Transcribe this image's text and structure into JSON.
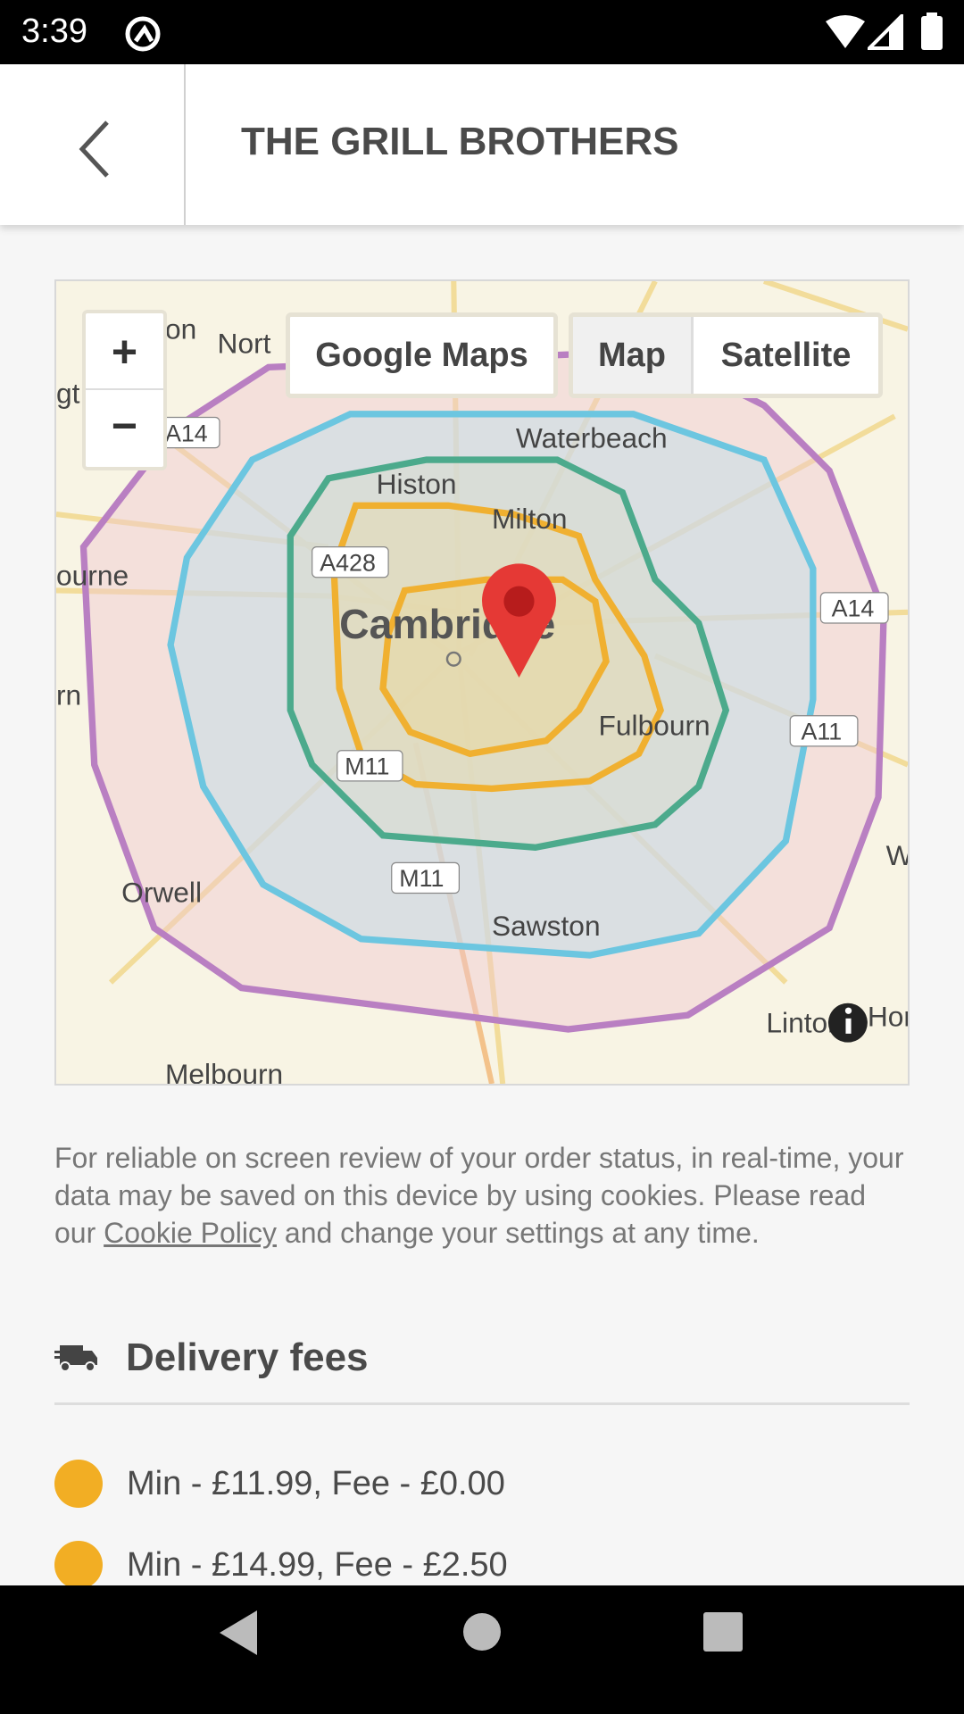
{
  "status_bar": {
    "time": "3:39"
  },
  "header": {
    "title": "THE GRILL BROTHERS"
  },
  "map": {
    "google_maps_button": "Google Maps",
    "map_type_map": "Map",
    "map_type_satellite": "Satellite",
    "zoom_in": "+",
    "zoom_out": "−",
    "places": [
      "Nort",
      "Waterbeach",
      "Histon",
      "Milton",
      "Cambridge",
      "Fulbourn",
      "Orwell",
      "Sawston",
      "Melbourn",
      "Linton",
      "Hor",
      "ourne",
      "rn",
      "gt",
      "on",
      "W"
    ],
    "roads": [
      "A14",
      "A428",
      "M11",
      "M11",
      "A14",
      "A11"
    ],
    "zone_colors": [
      "#b97fc2",
      "#6cc6e0",
      "#4caa8c",
      "#f0b030",
      "#f0b030"
    ],
    "pin_color": "#e53935"
  },
  "cookie_notice": {
    "before": "For reliable on screen review of your order status, in real-time, your data may be saved on this device by using cookies. Please read our ",
    "link": "Cookie Policy",
    "after": " and change your settings at any time."
  },
  "delivery_fees": {
    "heading": "Delivery fees",
    "icon": "truck-icon",
    "items": [
      {
        "label": "Min - £11.99, Fee - £0.00",
        "color": "#f2ae24"
      },
      {
        "label": "Min - £14.99, Fee - £2.50",
        "color": "#f2ae24"
      }
    ]
  }
}
